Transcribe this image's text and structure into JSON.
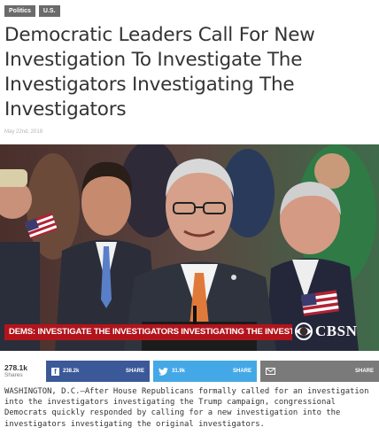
{
  "tags": [
    "Politics",
    "U.S."
  ],
  "headline": "Democratic Leaders Call For New Investigation To Investigate The Investigators Investigating The Investigators",
  "date": "May 22nd, 2018",
  "image": {
    "chyron": "DEMS: INVESTIGATE THE INVESTIGATORS INVESTIGATING THE INVESTIGATORS",
    "logo_text": "CBSN"
  },
  "share": {
    "total": "278.1k",
    "total_label": "Shares",
    "facebook_count": "238.2k",
    "facebook_label": "SHARE",
    "twitter_count": "31.9k",
    "twitter_label": "SHARE",
    "email_label": "SHARE"
  },
  "body": "WASHINGTON, D.C.—After House Republicans formally called for an investigation into the investigators investigating the Trump campaign, congressional Democrats quickly responded by calling for a new investigation into the investigators investigating the original investigators.",
  "colors": {
    "chyron_red": "#b2141c",
    "facebook_blue": "#3b5998",
    "twitter_blue": "#45a8e6",
    "email_gray": "#7a7a7a"
  }
}
